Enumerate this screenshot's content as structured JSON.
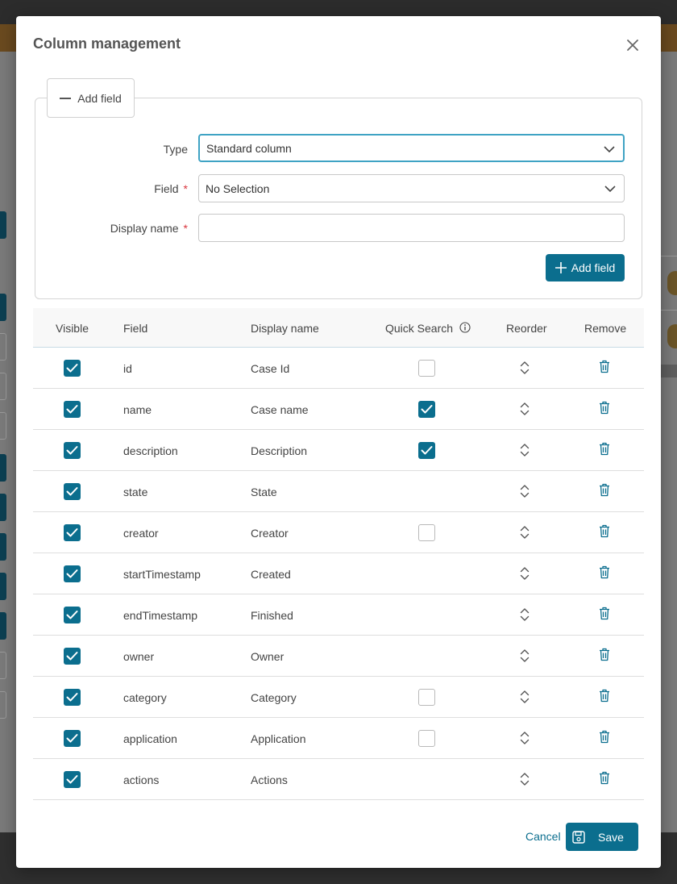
{
  "modal": {
    "title": "Column management"
  },
  "add_field_panel": {
    "collapse_label": "Add field",
    "type_label": "Type",
    "type_value": "Standard column",
    "field_label": "Field",
    "field_required": "*",
    "field_value": "No Selection",
    "display_name_label": "Display name",
    "display_name_required": "*",
    "display_name_value": "",
    "add_button_label": "Add field"
  },
  "table": {
    "headers": {
      "visible": "Visible",
      "field": "Field",
      "display_name": "Display name",
      "quick_search": "Quick Search",
      "reorder": "Reorder",
      "remove": "Remove"
    },
    "rows": [
      {
        "visible": true,
        "field": "id",
        "display_name": "Case Id",
        "quick_search": false
      },
      {
        "visible": true,
        "field": "name",
        "display_name": "Case name",
        "quick_search": true
      },
      {
        "visible": true,
        "field": "description",
        "display_name": "Description",
        "quick_search": true
      },
      {
        "visible": true,
        "field": "state",
        "display_name": "State",
        "quick_search": null
      },
      {
        "visible": true,
        "field": "creator",
        "display_name": "Creator",
        "quick_search": false
      },
      {
        "visible": true,
        "field": "startTimestamp",
        "display_name": "Created",
        "quick_search": null
      },
      {
        "visible": true,
        "field": "endTimestamp",
        "display_name": "Finished",
        "quick_search": null
      },
      {
        "visible": true,
        "field": "owner",
        "display_name": "Owner",
        "quick_search": null
      },
      {
        "visible": true,
        "field": "category",
        "display_name": "Category",
        "quick_search": false
      },
      {
        "visible": true,
        "field": "application",
        "display_name": "Application",
        "quick_search": false
      },
      {
        "visible": true,
        "field": "actions",
        "display_name": "Actions",
        "quick_search": null
      }
    ]
  },
  "footer": {
    "cancel_label": "Cancel",
    "save_label": "Save"
  },
  "icons": {
    "close": "close-icon",
    "collapse": "minus-icon",
    "chevron": "chevron-down-icon",
    "add": "plus-icon",
    "info": "info-icon",
    "check": "check-icon",
    "reorder": "sort-arrows-icon",
    "remove": "trash-icon",
    "save": "floppy-disk-icon"
  },
  "colors": {
    "accent": "#0b6e8e",
    "focus": "#3fa3c4",
    "required": "#d9363e"
  }
}
